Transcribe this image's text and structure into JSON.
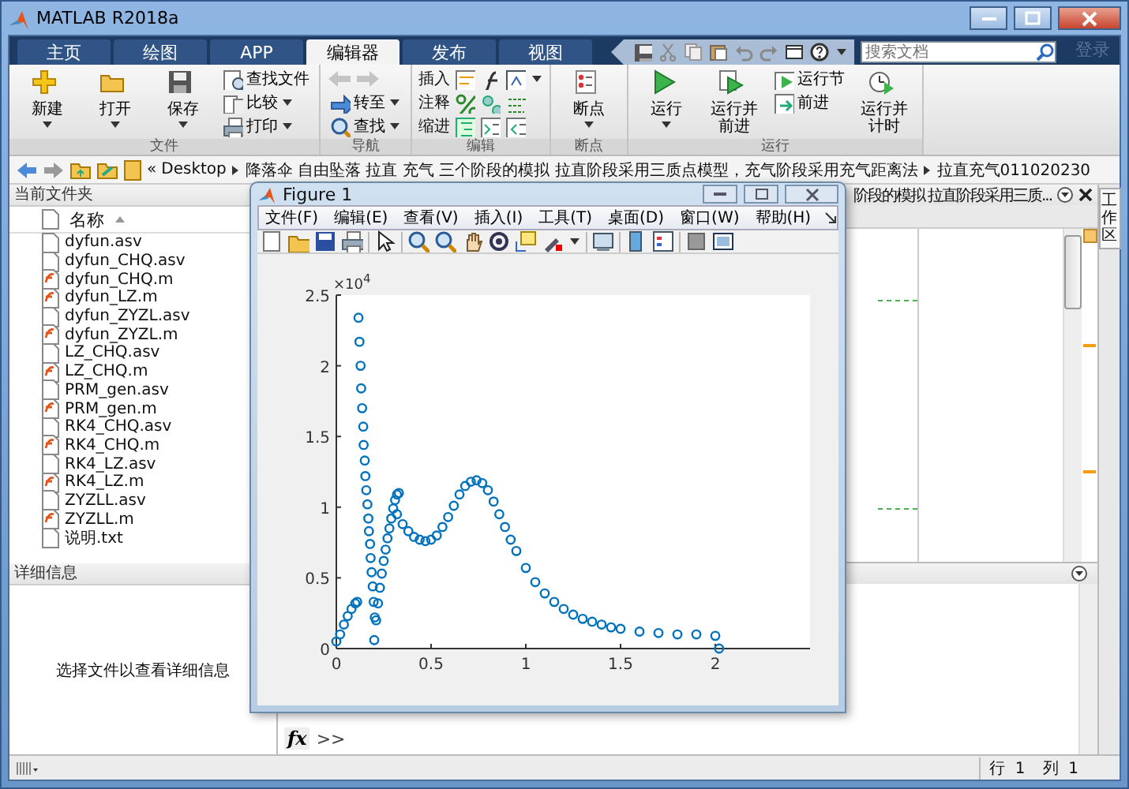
{
  "window": {
    "title": "MATLAB R2018a"
  },
  "tabs": [
    {
      "label": "主页",
      "selected": false
    },
    {
      "label": "绘图",
      "selected": false
    },
    {
      "label": "APP",
      "selected": false
    },
    {
      "label": "编辑器",
      "selected": true
    },
    {
      "label": "发布",
      "selected": false
    },
    {
      "label": "视图",
      "selected": false
    }
  ],
  "search": {
    "placeholder": "搜索文档"
  },
  "sign_in": "登录",
  "ribbon": {
    "groups": [
      {
        "label": "文件",
        "items": [
          {
            "kind": "large",
            "label": "新建",
            "dropdown": true
          },
          {
            "kind": "large",
            "label": "打开",
            "dropdown": true
          },
          {
            "kind": "large",
            "label": "保存",
            "dropdown": true
          },
          {
            "kind": "small",
            "label": "查找文件",
            "dropdown": false
          },
          {
            "kind": "small",
            "label": "比较",
            "dropdown": true
          },
          {
            "kind": "small",
            "label": "打印",
            "dropdown": true
          }
        ]
      },
      {
        "label": "导航",
        "items": [
          {
            "kind": "arrows",
            "disabled": true
          },
          {
            "kind": "small",
            "label": "转至",
            "dropdown": true
          },
          {
            "kind": "small",
            "label": "查找",
            "dropdown": true
          }
        ]
      },
      {
        "label": "编辑",
        "items": [
          {
            "kind": "row",
            "label": "插入",
            "dropdown": true
          },
          {
            "kind": "row",
            "label": "注释",
            "dropdown": false
          },
          {
            "kind": "row",
            "label": "缩进",
            "dropdown": false
          }
        ]
      },
      {
        "label": "断点",
        "items": [
          {
            "kind": "large",
            "label": "断点",
            "dropdown": true
          }
        ]
      },
      {
        "label": "运行",
        "items": [
          {
            "kind": "large",
            "label": "运行",
            "dropdown": true
          },
          {
            "kind": "large",
            "label": "运行并前进",
            "dropdown": false
          },
          {
            "kind": "small",
            "label": "运行节",
            "dropdown": false
          },
          {
            "kind": "small",
            "label": "前进",
            "dropdown": false
          },
          {
            "kind": "large",
            "label": "运行并计时",
            "dropdown": false
          }
        ]
      }
    ]
  },
  "address": {
    "overflow_mark": "«",
    "path": [
      "Desktop",
      "降落伞 自由坠落 拉直 充气 三个阶段的模拟 拉直阶段采用三质点模型，充气阶段采用充气距离法",
      "拉直充气011020230"
    ]
  },
  "current_folder": {
    "title": "当前文件夹",
    "column": "名称",
    "files": [
      {
        "name": "dyfun.asv",
        "kind": "file"
      },
      {
        "name": "dyfun_CHQ.asv",
        "kind": "file"
      },
      {
        "name": "dyfun_CHQ.m",
        "kind": "script"
      },
      {
        "name": "dyfun_LZ.m",
        "kind": "script"
      },
      {
        "name": "dyfun_ZYZL.asv",
        "kind": "file"
      },
      {
        "name": "dyfun_ZYZL.m",
        "kind": "script"
      },
      {
        "name": "LZ_CHQ.asv",
        "kind": "file"
      },
      {
        "name": "LZ_CHQ.m",
        "kind": "script"
      },
      {
        "name": "PRM_gen.asv",
        "kind": "file"
      },
      {
        "name": "PRM_gen.m",
        "kind": "script"
      },
      {
        "name": "RK4_CHQ.asv",
        "kind": "file"
      },
      {
        "name": "RK4_CHQ.m",
        "kind": "script"
      },
      {
        "name": "RK4_LZ.asv",
        "kind": "file"
      },
      {
        "name": "RK4_LZ.m",
        "kind": "script"
      },
      {
        "name": "ZYZLL.asv",
        "kind": "file"
      },
      {
        "name": "ZYZLL.m",
        "kind": "script"
      },
      {
        "name": "说明.txt",
        "kind": "file"
      }
    ]
  },
  "details": {
    "title": "详细信息",
    "message": "选择文件以查看详细信息"
  },
  "editor": {
    "tab_title": "阶段的模拟 拉直阶段采用三质..."
  },
  "workspace_tab": "工作区",
  "command_window": {
    "function_button": "fx",
    "prompt": ">>"
  },
  "status_bar": {
    "row_label": "行",
    "row": "1",
    "col_label": "列",
    "col": "1"
  },
  "figure": {
    "title": "Figure 1",
    "menus": [
      "文件(F)",
      "编辑(E)",
      "查看(V)",
      "插入(I)",
      "工具(T)",
      "桌面(D)",
      "窗口(W)",
      "帮助(H)"
    ],
    "y_exponent": "×10$^{4}$",
    "chart_data": {
      "type": "scatter",
      "xlim": [
        0,
        2.5
      ],
      "ylim": [
        0,
        2.5
      ],
      "xticks": [
        0,
        0.5,
        1,
        1.5,
        2
      ],
      "yticks": [
        0,
        0.5,
        1,
        1.5,
        2,
        2.5
      ],
      "series": [
        {
          "color": "#0072bd",
          "x": [
            0,
            0.02,
            0.04,
            0.06,
            0.08,
            0.1,
            0.11,
            0.117,
            0.122,
            0.128,
            0.131,
            0.136,
            0.142,
            0.144,
            0.15,
            0.153,
            0.158,
            0.164,
            0.169,
            0.172,
            0.178,
            0.181,
            0.186,
            0.192,
            0.197,
            0.203,
            0.2,
            0.21,
            0.22,
            0.23,
            0.24,
            0.25,
            0.26,
            0.27,
            0.28,
            0.29,
            0.3,
            0.31,
            0.32,
            0.33,
            0.32,
            0.35,
            0.38,
            0.41,
            0.44,
            0.47,
            0.5,
            0.53,
            0.56,
            0.59,
            0.62,
            0.65,
            0.68,
            0.71,
            0.74,
            0.77,
            0.8,
            0.83,
            0.86,
            0.89,
            0.92,
            0.95,
            1.0,
            1.05,
            1.1,
            1.15,
            1.2,
            1.25,
            1.3,
            1.35,
            1.4,
            1.45,
            1.5,
            1.6,
            1.7,
            1.8,
            1.9,
            2.0,
            2.02
          ],
          "values": [
            0.05,
            0.1,
            0.17,
            0.23,
            0.28,
            0.32,
            0.33,
            2.34,
            2.17,
            2.0,
            1.84,
            1.7,
            1.57,
            1.44,
            1.33,
            1.22,
            1.12,
            1.02,
            0.92,
            0.83,
            0.74,
            0.64,
            0.54,
            0.44,
            0.33,
            0.22,
            0.06,
            0.2,
            0.32,
            0.43,
            0.53,
            0.62,
            0.7,
            0.78,
            0.85,
            0.92,
            0.99,
            1.05,
            1.09,
            1.1,
            0.95,
            0.88,
            0.83,
            0.79,
            0.77,
            0.76,
            0.77,
            0.8,
            0.86,
            0.93,
            1.01,
            1.09,
            1.15,
            1.18,
            1.19,
            1.17,
            1.12,
            1.04,
            0.95,
            0.86,
            0.77,
            0.69,
            0.57,
            0.47,
            0.39,
            0.33,
            0.28,
            0.24,
            0.21,
            0.19,
            0.17,
            0.15,
            0.14,
            0.12,
            0.11,
            0.1,
            0.1,
            0.09,
            0
          ]
        }
      ]
    }
  }
}
